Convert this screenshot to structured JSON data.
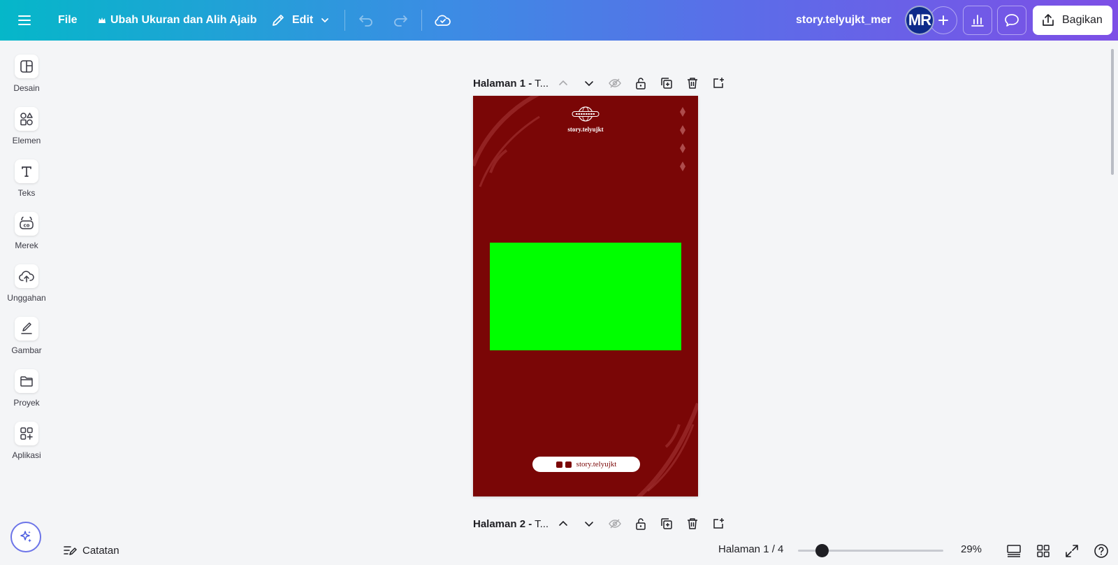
{
  "topbar": {
    "menu_icon": "hamburger-icon",
    "file_label": "File",
    "resize_label": "Ubah Ukuran dan Alih Ajaib",
    "edit_label": "Edit",
    "doc_title": "story.telyujkt_mer",
    "avatar_initials": "MR",
    "share_label": "Bagikan"
  },
  "sidebar": {
    "items": [
      {
        "label": "Desain",
        "icon": "layout-icon"
      },
      {
        "label": "Elemen",
        "icon": "shapes-icon"
      },
      {
        "label": "Teks",
        "icon": "text-icon"
      },
      {
        "label": "Merek",
        "icon": "brand-icon"
      },
      {
        "label": "Unggahan",
        "icon": "cloud-upload-icon"
      },
      {
        "label": "Gambar",
        "icon": "draw-icon"
      },
      {
        "label": "Proyek",
        "icon": "folder-icon"
      },
      {
        "label": "Aplikasi",
        "icon": "apps-icon"
      }
    ]
  },
  "pages": [
    {
      "title_bold": "Halaman 1 -",
      "title_rest": " T..."
    },
    {
      "title_bold": "Halaman 2 -",
      "title_rest": " T..."
    }
  ],
  "canvas": {
    "logo_text": "story.telyujkt",
    "footer_handle": "story.telyujkt",
    "background_color": "#7a0606",
    "placeholder_color": "#00ff00"
  },
  "bottom": {
    "notes_label": "Catatan",
    "page_indicator": "Halaman 1 / 4",
    "zoom_label": "29%",
    "zoom_value": 0.29
  },
  "colors": {
    "accent_gradient_start": "#05b7c9",
    "accent_gradient_end": "#7d4fe6"
  }
}
